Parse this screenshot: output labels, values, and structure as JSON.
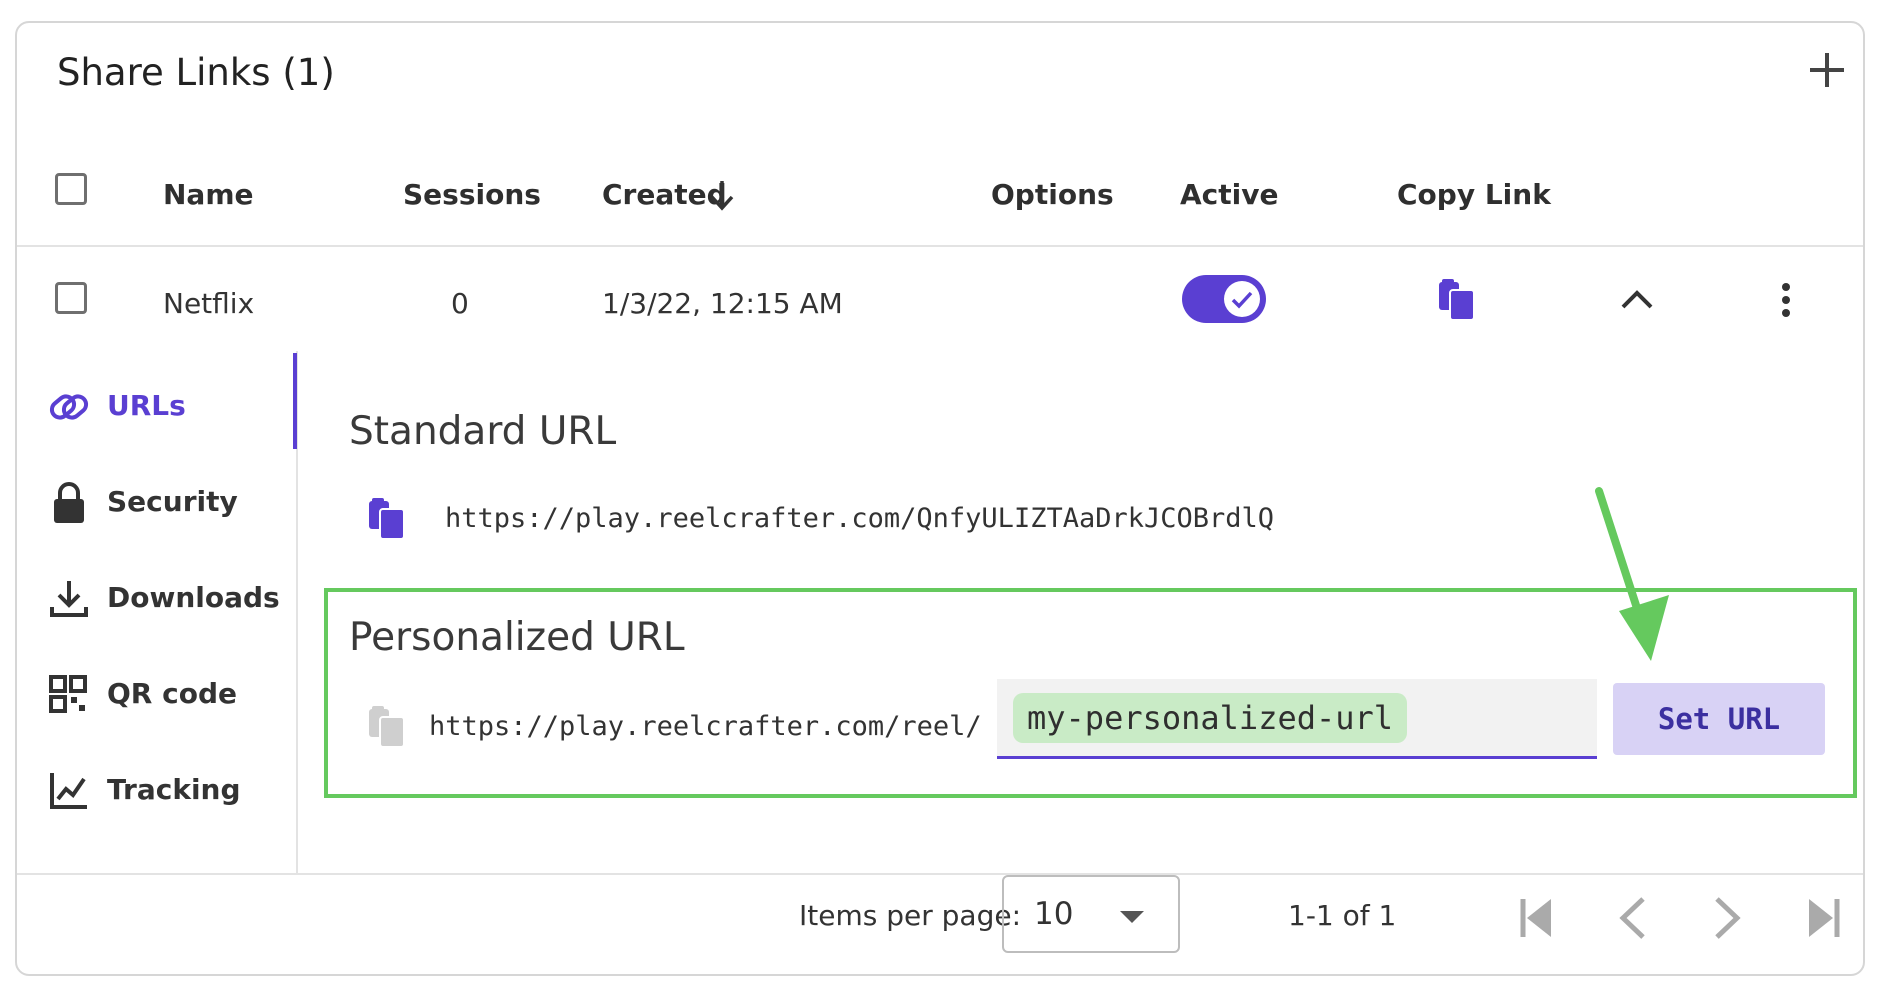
{
  "header": {
    "title": "Share Links (1)",
    "add_icon": "plus-icon"
  },
  "table": {
    "columns": [
      "Name",
      "Sessions",
      "Created",
      "Options",
      "Active",
      "Copy Link"
    ],
    "rows": [
      {
        "name": "Netflix",
        "sessions": "0",
        "created": "1/3/22, 12:15 AM",
        "active": true
      }
    ]
  },
  "side_nav": {
    "items": [
      {
        "label": "URLs",
        "icon": "link-icon",
        "active": true
      },
      {
        "label": "Security",
        "icon": "lock-icon"
      },
      {
        "label": "Downloads",
        "icon": "download-icon"
      },
      {
        "label": "QR code",
        "icon": "qr-code-icon"
      },
      {
        "label": "Tracking",
        "icon": "chart-icon"
      }
    ]
  },
  "urls": {
    "standard": {
      "heading": "Standard URL",
      "url": "https://play.reelcrafter.com/QnfyULIZTAaDrkJCOBrdlQ"
    },
    "personalized": {
      "heading": "Personalized URL",
      "prefix": "https://play.reelcrafter.com/reel/",
      "value": "my-personalized-url",
      "button": "Set URL"
    }
  },
  "pagination": {
    "items_per_page_label": "Items per page:",
    "items_per_page": "10",
    "range": "1-1 of 1"
  },
  "colors": {
    "accent": "#5a3fd2",
    "highlight_green": "#65c95e",
    "input_highlight": "#c9ebc6",
    "button_bg": "#d8d2f5"
  }
}
